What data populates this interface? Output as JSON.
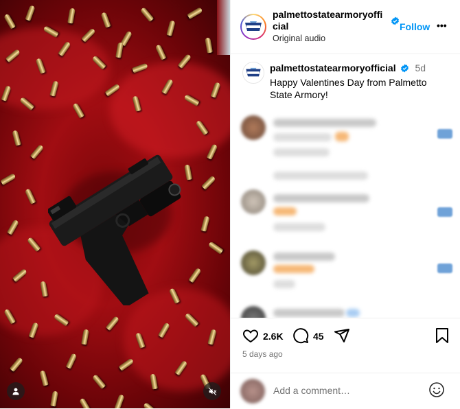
{
  "post": {
    "username": "palmettostatearmoryofficial",
    "username_wrapped": [
      "palmettostatearmoryoffi",
      "cial"
    ],
    "audio": "Original audio",
    "follow_label": "Follow",
    "more_label": "•••",
    "caption": "Happy Valentines Day from Palmetto State Armory!",
    "caption_lines": [
      "Happy Valentines Day from Palmetto",
      "State Armory!"
    ],
    "caption_age": "5d",
    "likes": "2.6K",
    "comments": "45",
    "posted_ago": "5 days ago",
    "add_comment_placeholder": "Add a comment…"
  },
  "icons": {
    "verified": "verified-badge-icon",
    "like": "heart-icon",
    "comment": "speech-bubble-icon",
    "share": "paper-plane-icon",
    "save": "bookmark-icon",
    "emoji": "smiley-icon",
    "mute": "speaker-muted-icon",
    "tagged": "person-icon"
  },
  "colors": {
    "accent": "#0095f6",
    "verified": "#0095f6",
    "muted_text": "#737373",
    "background_red": "#a10d12"
  }
}
